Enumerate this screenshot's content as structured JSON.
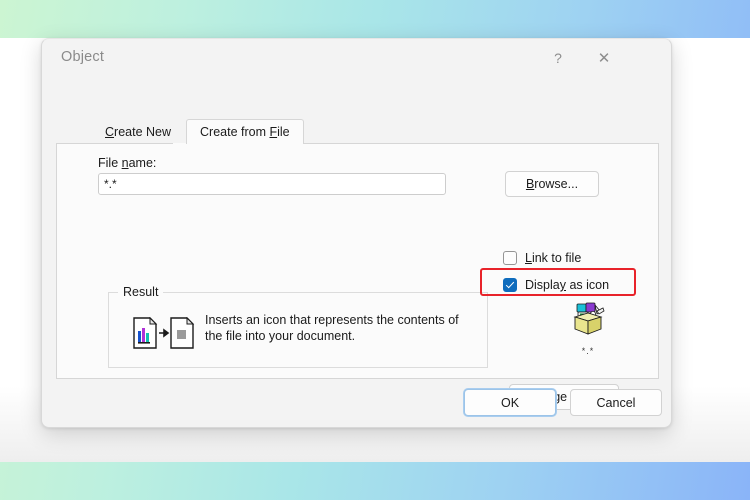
{
  "dialog": {
    "title": "Object",
    "help_icon": "?",
    "close_icon": "✕",
    "tabs": [
      {
        "label_before": "C",
        "label_accel": "C",
        "label": "Create New",
        "accel_index": 0,
        "selected": false,
        "name": "create-new"
      },
      {
        "label": "Create from File",
        "accel_index": 12,
        "selected": true,
        "name": "create-from-file"
      }
    ],
    "file_name": {
      "label": "File name:",
      "label_accel_index": 5,
      "value": "*.*",
      "placeholder": ""
    },
    "browse_button": {
      "label": "Browse...",
      "accel_index": 0
    },
    "checkboxes": [
      {
        "label": "Link to file",
        "accel_index": 0,
        "checked": false,
        "name": "link-to-file"
      },
      {
        "label": "Display as icon",
        "accel_index": 6,
        "checked": true,
        "name": "display-as-icon"
      }
    ],
    "result": {
      "legend": "Result",
      "description": "Inserts an icon that represents the contents of the file into your document."
    },
    "package_preview": {
      "caption": "*.*",
      "icon": "package-box-icon"
    },
    "change_icon_button": {
      "label": "Change Icon...",
      "accel_index": 7
    },
    "ok_button": {
      "label": "OK"
    },
    "cancel_button": {
      "label": "Cancel"
    }
  },
  "annotation": {
    "highlight_color": "#e8232a",
    "highlight_target": "Display as icon"
  },
  "theme": {
    "accent": "#0f6cbd",
    "dialog_bg": "#f3f3f3",
    "page_bg": "#fbfbfb",
    "background_gradient_from": "#ccf5d2",
    "background_gradient_to": "#8ab4f8"
  }
}
